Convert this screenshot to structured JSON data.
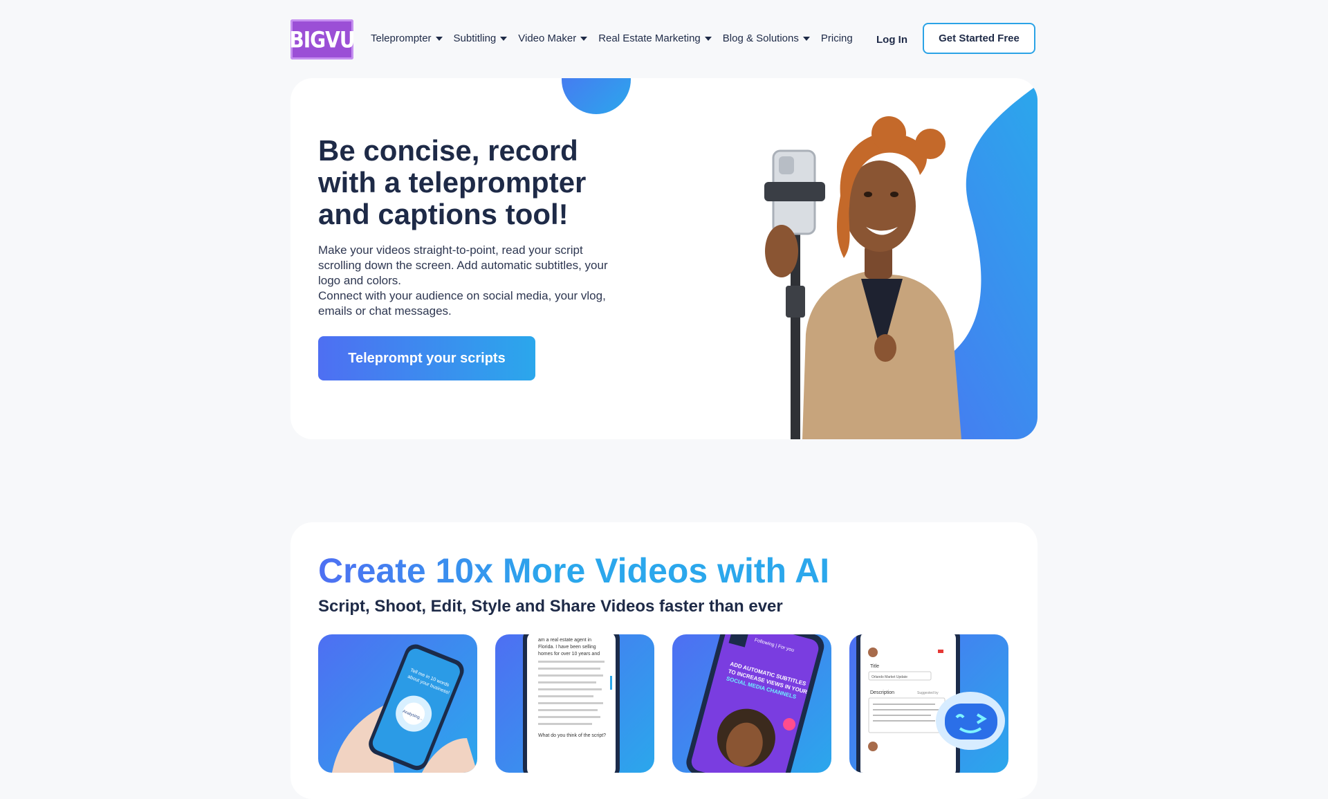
{
  "header": {
    "logo_text": "BIGVU",
    "nav": [
      {
        "label": "Teleprompter",
        "has_dropdown": true
      },
      {
        "label": "Subtitling",
        "has_dropdown": true
      },
      {
        "label": "Video Maker",
        "has_dropdown": true
      },
      {
        "label": "Real Estate Marketing",
        "has_dropdown": true
      },
      {
        "label": "Blog & Solutions",
        "has_dropdown": true
      },
      {
        "label": "Pricing",
        "has_dropdown": false
      }
    ],
    "login_label": "Log In",
    "cta_label": "Get Started Free"
  },
  "hero": {
    "title": "Be concise, record with a teleprompter and captions tool!",
    "description_1": "Make your videos straight-to-point, read your script scrolling down the screen. Add automatic subtitles, your logo and colors.",
    "description_2": "Connect with your audience on social media, your vlog, emails or chat messages.",
    "button_label": "Teleprompt your scripts"
  },
  "ai_section": {
    "title": "Create 10x More Videos with AI",
    "subtitle": "Script, Shoot, Edit, Style and Share Videos faster than ever",
    "cards": [
      {
        "name": "ai-script-card",
        "phone_text_1": "Tell me in 10 words",
        "phone_text_2": "about your business!",
        "phone_text_3": "Analysing..."
      },
      {
        "name": "teleprompter-card",
        "phone_text_1": "am a real estate agent in",
        "phone_text_2": "Florida. I have been selling",
        "phone_text_3": "homes for over 10 years and",
        "phone_text_4": "What do you think of the script?"
      },
      {
        "name": "subtitles-card",
        "phone_text_1": "Following | For you",
        "phone_text_2": "ADD AUTOMATIC SUBTITLES",
        "phone_text_3": "TO INCREASE VIEWS IN YOUR",
        "phone_text_4": "SOCIAL MEDIA CHANNELS"
      },
      {
        "name": "ai-description-card",
        "phone_text_1": "Title",
        "phone_text_2": "Orlando Market Update",
        "phone_text_3": "Description",
        "phone_text_4": "Suggested by"
      }
    ]
  },
  "colors": {
    "brand_purple": "#9b4fd6",
    "accent_blue": "#2ba7ec",
    "accent_indigo": "#4e6ff2",
    "text_dark": "#1e2a47"
  }
}
